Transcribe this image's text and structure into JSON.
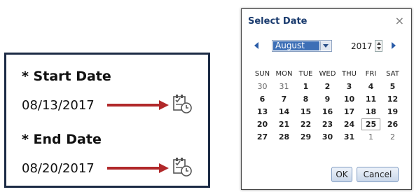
{
  "form": {
    "start_label": "* Start Date",
    "start_value": "08/13/2017",
    "end_label": "* End Date",
    "end_value": "08/20/2017",
    "arrow_color": "#b1282a"
  },
  "dialog": {
    "title": "Select Date",
    "close_glyph": "×",
    "month": "August",
    "year": "2017",
    "weekdays": [
      "SUN",
      "MON",
      "TUE",
      "WED",
      "THU",
      "FRI",
      "SAT"
    ],
    "weeks": [
      [
        "30",
        "31",
        "1",
        "2",
        "3",
        "4",
        "5"
      ],
      [
        "6",
        "7",
        "8",
        "9",
        "10",
        "11",
        "12"
      ],
      [
        "13",
        "14",
        "15",
        "16",
        "17",
        "18",
        "19"
      ],
      [
        "20",
        "21",
        "22",
        "23",
        "24",
        "25",
        "26"
      ],
      [
        "27",
        "28",
        "29",
        "30",
        "31",
        "1",
        "2"
      ]
    ],
    "ok_label": "OK",
    "cancel_label": "Cancel"
  }
}
